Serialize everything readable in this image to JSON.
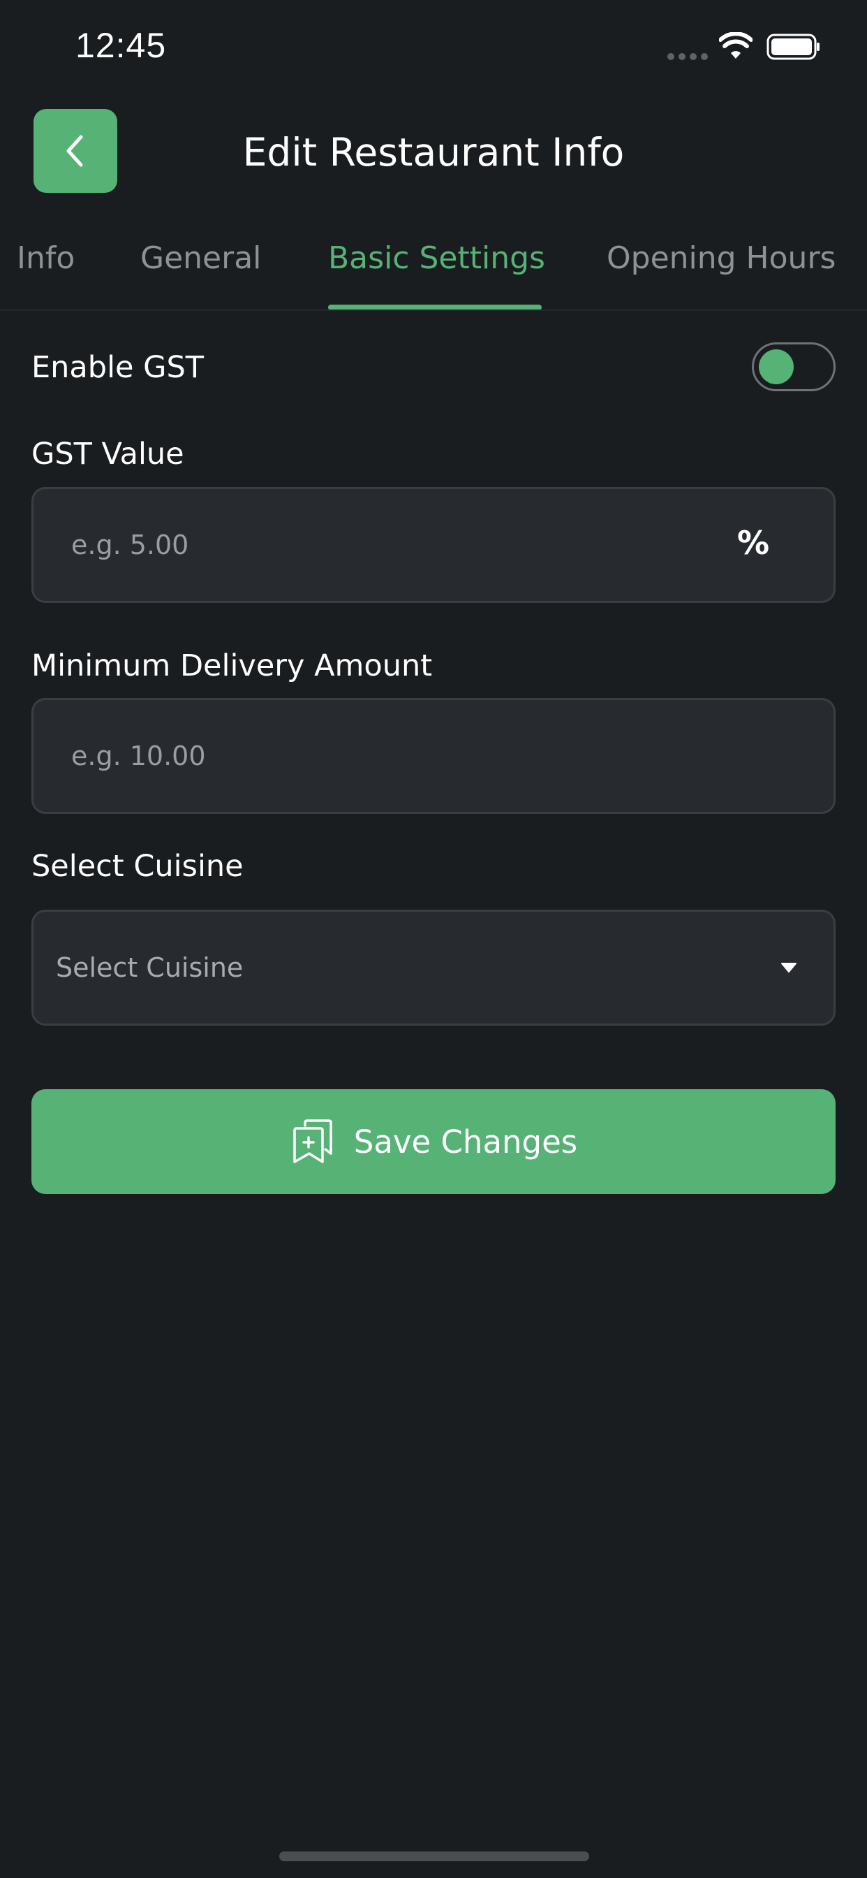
{
  "status_bar": {
    "time": "12:45"
  },
  "header": {
    "title": "Edit Restaurant Info",
    "back_icon": "chevron-left-icon"
  },
  "tabs": [
    {
      "label": "Info",
      "active": false
    },
    {
      "label": "General",
      "active": false
    },
    {
      "label": "Basic Settings",
      "active": true
    },
    {
      "label": "Opening Hours",
      "active": false
    }
  ],
  "form": {
    "enable_gst": {
      "label": "Enable GST",
      "enabled": true
    },
    "gst_value": {
      "label": "GST Value",
      "placeholder": "e.g. 5.00",
      "value": "",
      "unit": "%"
    },
    "min_delivery": {
      "label": "Minimum Delivery Amount",
      "placeholder": "e.g. 10.00",
      "value": ""
    },
    "cuisine": {
      "label": "Select Cuisine",
      "selected": "Select Cuisine"
    }
  },
  "save_button": {
    "label": "Save Changes",
    "icon": "bookmark-add-icon"
  },
  "colors": {
    "accent": "#56b275",
    "background": "#1a1d20",
    "field_background": "#272a2e",
    "field_border": "#3a3e42",
    "muted_text": "#8e9296"
  }
}
